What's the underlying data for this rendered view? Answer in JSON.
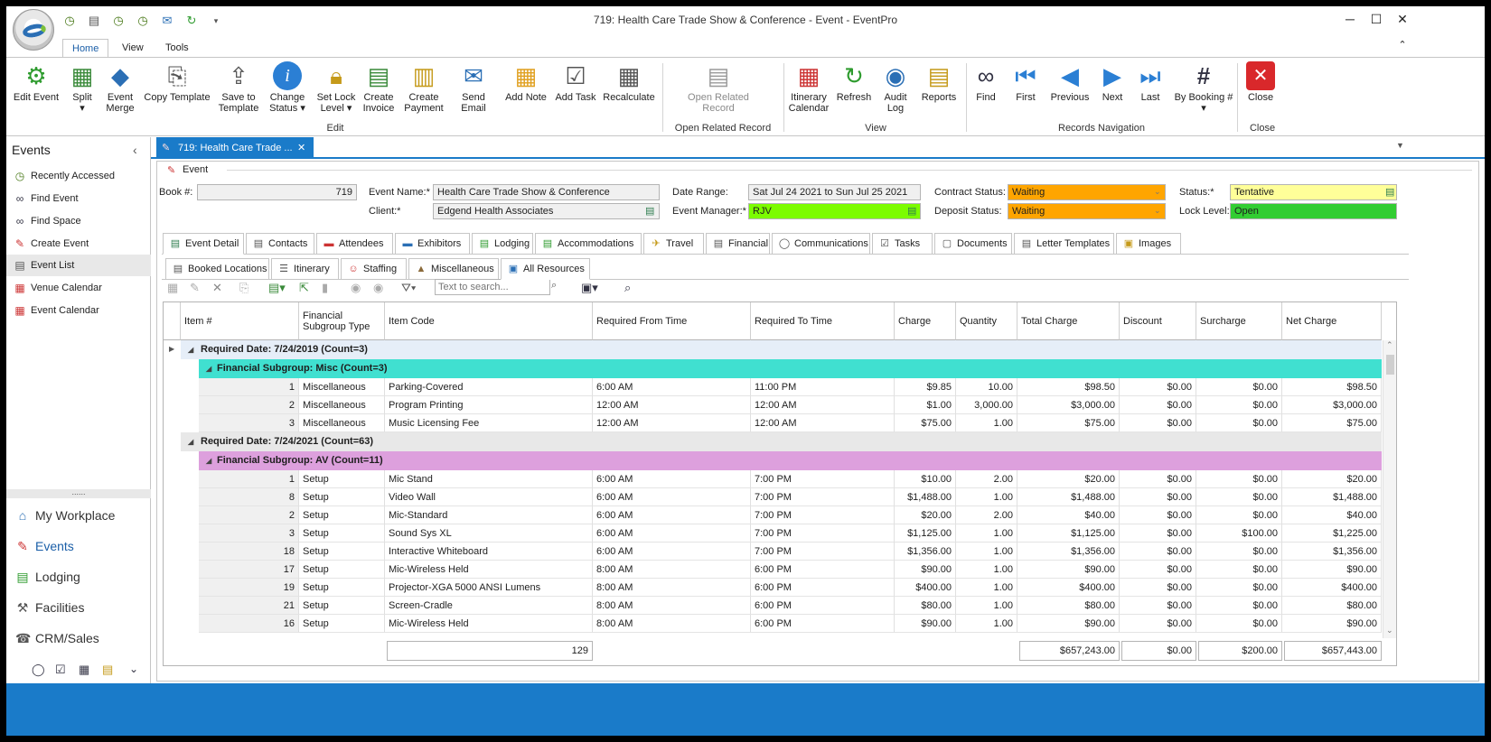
{
  "app": {
    "title": "719: Health Care Trade Show & Conference - Event - EventPro"
  },
  "ribbon_tabs": [
    "Home",
    "View",
    "Tools"
  ],
  "ribbon": {
    "edit_buttons": [
      {
        "l1": "Edit Event",
        "l2": "",
        "icon": "gear-icon"
      },
      {
        "l1": "Split",
        "l2": "▾",
        "icon": "split-icon"
      },
      {
        "l1": "Event",
        "l2": "Merge",
        "icon": "merge-icon"
      },
      {
        "l1": "Copy Template",
        "l2": "",
        "icon": "copy-template-icon"
      },
      {
        "l1": "Save to",
        "l2": "Template",
        "icon": "save-template-icon"
      },
      {
        "l1": "Change",
        "l2": "Status ▾",
        "icon": "info-icon"
      },
      {
        "l1": "Set Lock",
        "l2": "Level ▾",
        "icon": "lock-icon"
      },
      {
        "l1": "Create",
        "l2": "Invoice",
        "icon": "invoice-icon"
      },
      {
        "l1": "Create",
        "l2": "Payment",
        "icon": "payment-icon"
      },
      {
        "l1": "Send Email",
        "l2": "",
        "icon": "email-icon"
      },
      {
        "l1": "Add Note",
        "l2": "",
        "icon": "note-icon"
      },
      {
        "l1": "Add Task",
        "l2": "",
        "icon": "task-icon"
      },
      {
        "l1": "Recalculate",
        "l2": "",
        "icon": "calculator-icon"
      }
    ],
    "open_related": {
      "l1": "Open Related",
      "l2": "Record"
    },
    "view_buttons": [
      {
        "l1": "Itinerary",
        "l2": "Calendar"
      },
      {
        "l1": "Refresh",
        "l2": ""
      },
      {
        "l1": "Audit",
        "l2": "Log"
      },
      {
        "l1": "Reports",
        "l2": ""
      }
    ],
    "nav_buttons": [
      {
        "l1": "Find",
        "l2": ""
      },
      {
        "l1": "First",
        "l2": ""
      },
      {
        "l1": "Previous",
        "l2": ""
      },
      {
        "l1": "Next",
        "l2": ""
      },
      {
        "l1": "Last",
        "l2": ""
      },
      {
        "l1": "By Booking #",
        "l2": "▾"
      }
    ],
    "close": {
      "l1": "Close"
    },
    "groups": {
      "edit": "Edit",
      "open_related": "Open Related Record",
      "view": "View",
      "nav": "Records Navigation",
      "close": "Close"
    }
  },
  "nav": {
    "header": "Events",
    "items": [
      "Recently Accessed",
      "Find Event",
      "Find Space",
      "Create Event",
      "Event List",
      "Venue Calendar",
      "Event Calendar"
    ],
    "dots": "......",
    "modules": [
      "My Workplace",
      "Events",
      "Lodging",
      "Facilities",
      "CRM/Sales"
    ]
  },
  "doc_tab": "719: Health Care Trade ...",
  "event": {
    "section": "Event",
    "book_label": "Book #:",
    "book": "719",
    "name_label": "Event Name:*",
    "name": "Health Care Trade Show & Conference",
    "client_label": "Client:*",
    "client": "Edgend Health Associates",
    "date_label": "Date Range:",
    "date": "Sat Jul 24 2021 to Sun Jul 25 2021",
    "manager_label": "Event Manager:*",
    "manager": "RJV",
    "contract_label": "Contract Status:",
    "contract": "Waiting",
    "deposit_label": "Deposit Status:",
    "deposit": "Waiting",
    "status_label": "Status:*",
    "status": "Tentative",
    "lock_label": "Lock Level:",
    "lock": "Open"
  },
  "tabs": [
    "Event Detail",
    "Contacts",
    "Attendees",
    "Exhibitors",
    "Lodging",
    "Accommodations",
    "Travel",
    "Financial",
    "Communications",
    "Tasks",
    "Documents",
    "Letter Templates",
    "Images"
  ],
  "subtabs": [
    "Booked Locations",
    "Itinerary",
    "Staffing",
    "Miscellaneous",
    "All Resources"
  ],
  "search": {
    "placeholder": "Text to search..."
  },
  "grid": {
    "columns": [
      "Item #",
      "Financial Subgroup Type",
      "Item Code",
      "Required From Time",
      "Required To Time",
      "Charge",
      "Quantity",
      "Total Charge",
      "Discount",
      "Surcharge",
      "Net Charge"
    ],
    "group1": "Required Date: 7/24/2019 (Count=3)",
    "sub1": "Financial Subgroup: Misc (Count=3)",
    "rows1": [
      [
        "1",
        "Miscellaneous",
        "Parking-Covered",
        "6:00 AM",
        "11:00 PM",
        "$9.85",
        "10.00",
        "$98.50",
        "$0.00",
        "$0.00",
        "$98.50"
      ],
      [
        "2",
        "Miscellaneous",
        "Program Printing",
        "12:00 AM",
        "12:00 AM",
        "$1.00",
        "3,000.00",
        "$3,000.00",
        "$0.00",
        "$0.00",
        "$3,000.00"
      ],
      [
        "3",
        "Miscellaneous",
        "Music Licensing Fee",
        "12:00 AM",
        "12:00 AM",
        "$75.00",
        "1.00",
        "$75.00",
        "$0.00",
        "$0.00",
        "$75.00"
      ]
    ],
    "group2": "Required Date: 7/24/2021 (Count=63)",
    "sub2": "Financial Subgroup: AV (Count=11)",
    "rows2": [
      [
        "1",
        "Setup",
        "Mic Stand",
        "6:00 AM",
        "7:00 PM",
        "$10.00",
        "2.00",
        "$20.00",
        "$0.00",
        "$0.00",
        "$20.00"
      ],
      [
        "8",
        "Setup",
        "Video Wall",
        "6:00 AM",
        "7:00 PM",
        "$1,488.00",
        "1.00",
        "$1,488.00",
        "$0.00",
        "$0.00",
        "$1,488.00"
      ],
      [
        "2",
        "Setup",
        "Mic-Standard",
        "6:00 AM",
        "7:00 PM",
        "$20.00",
        "2.00",
        "$40.00",
        "$0.00",
        "$0.00",
        "$40.00"
      ],
      [
        "3",
        "Setup",
        "Sound Sys XL",
        "6:00 AM",
        "7:00 PM",
        "$1,125.00",
        "1.00",
        "$1,125.00",
        "$0.00",
        "$100.00",
        "$1,225.00"
      ],
      [
        "18",
        "Setup",
        "Interactive Whiteboard",
        "6:00 AM",
        "7:00 PM",
        "$1,356.00",
        "1.00",
        "$1,356.00",
        "$0.00",
        "$0.00",
        "$1,356.00"
      ],
      [
        "17",
        "Setup",
        "Mic-Wireless Held",
        "8:00 AM",
        "6:00 PM",
        "$90.00",
        "1.00",
        "$90.00",
        "$0.00",
        "$0.00",
        "$90.00"
      ],
      [
        "19",
        "Setup",
        "Projector-XGA 5000 ANSI Lumens",
        "8:00 AM",
        "6:00 PM",
        "$400.00",
        "1.00",
        "$400.00",
        "$0.00",
        "$0.00",
        "$400.00"
      ],
      [
        "21",
        "Setup",
        "Screen-Cradle",
        "8:00 AM",
        "6:00 PM",
        "$80.00",
        "1.00",
        "$80.00",
        "$0.00",
        "$0.00",
        "$80.00"
      ],
      [
        "16",
        "Setup",
        "Mic-Wireless Held",
        "8:00 AM",
        "6:00 PM",
        "$90.00",
        "1.00",
        "$90.00",
        "$0.00",
        "$0.00",
        "$90.00"
      ]
    ],
    "totals": {
      "count": "129",
      "total": "$657,243.00",
      "discount": "$0.00",
      "surcharge": "$200.00",
      "net": "$657,443.00"
    }
  },
  "colors": {
    "accent": "#1a7bc9",
    "misc_group": "#40e0d0",
    "av_group": "#dda0dd",
    "waiting": "#ffa500",
    "tentative": "#ffff99",
    "manager": "#7cfc00",
    "open": "#32cd32"
  }
}
